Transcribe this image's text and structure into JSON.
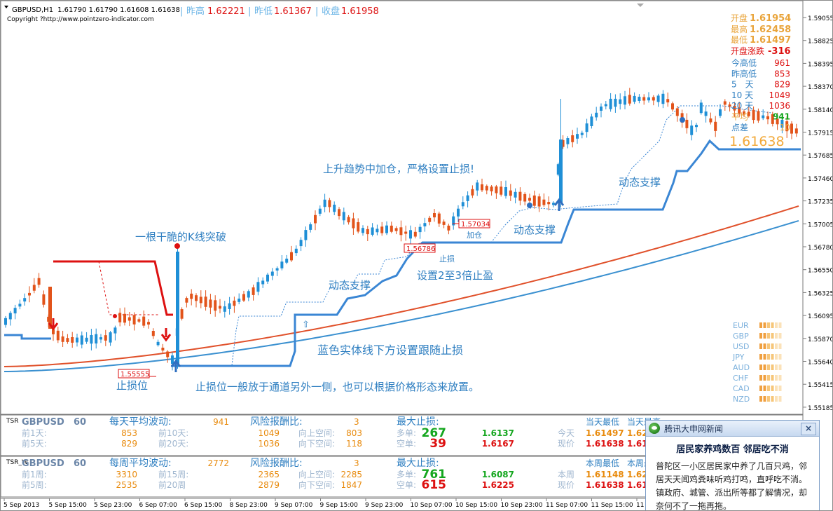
{
  "header": {
    "symbol": "GBPUSD,H1",
    "ohlc": "1.61790 1.61790 1.61608 1.61638",
    "copyright": "Copyright ?http://www.pointzero-indicator.com",
    "stats": [
      {
        "label": "昨高",
        "value": "1.62221"
      },
      {
        "label": "昨低",
        "value": "1.61367"
      },
      {
        "label": "收盘",
        "value": "1.61958"
      }
    ]
  },
  "right_info": {
    "open_label": "开盘",
    "open_value": "1.61954",
    "high_label": "最高",
    "high_value": "1.62458",
    "low_label": "最低",
    "low_value": "1.61497",
    "change_label": "开盘涨跌",
    "change_value": "-316",
    "rows": [
      {
        "label": "今高低",
        "value": "961"
      },
      {
        "label": "昨高低",
        "value": "853"
      },
      {
        "label": "5　天",
        "value": "829"
      },
      {
        "label": "10 天",
        "value": "1049"
      },
      {
        "label": "20 天",
        "value": "1036"
      },
      {
        "label": "平均",
        "value": "941"
      },
      {
        "label": "点差",
        "value": "10"
      }
    ],
    "price": "1.61638"
  },
  "price_axis": [
    "1.59055",
    "1.58825",
    "1.58395",
    "1.58370",
    "1.58140",
    "1.57915",
    "1.57685",
    "1.57460",
    "1.57235",
    "1.57005",
    "1.56780",
    "1.56550",
    "1.56325",
    "1.56095",
    "1.55870",
    "1.55640",
    "1.55415",
    "1.55185"
  ],
  "time_axis": [
    "5 Sep 2013",
    "5 Sep 15:00",
    "5 Sep 23:00",
    "6 Sep 07:00",
    "6 Sep 15:00",
    "8 Sep 23:00",
    "9 Sep 07:00",
    "9 Sep 15:00",
    "9 Sep 23:00",
    "10 Sep 07:00",
    "10 Sep 15:00",
    "10 Sep 23:00",
    "11 Sep 07:00",
    "11 Sep 15:00",
    "11 Sep 23:00"
  ],
  "currencies": [
    "EUR",
    "GBP",
    "USD",
    "JPY",
    "AUD",
    "CHF",
    "CAD",
    "NZD"
  ],
  "annotations": {
    "breakout": "一根干脆的K线突破",
    "uptrend": "上升趋势中加仓，严格设置止损!",
    "dyn_support_1": "动态支撑",
    "dyn_support_2": "动态支撑",
    "dyn_support_3": "动态支撑",
    "take_profit": "设置2至3倍止盈",
    "trailing": "蓝色实体线下方设置跟随止损",
    "stop_note": "止损位一般放于通道另外一侧，也可以根据价格形态来放置。",
    "stop_label": "止损位",
    "stop_small": "止损",
    "add_small": "加仓",
    "box_stop": "1.55555",
    "box_mid": "1.56786",
    "box_add": "1.57034",
    "up_arrow_char": "⇧"
  },
  "panel1": {
    "tag": "TSR",
    "symbol": "GBPUSD",
    "period": "60",
    "avg_label": "每天平均波动:",
    "avg_value": "941",
    "rr_label": "风险报酬比:",
    "rr_value": "3",
    "maxsl_label": "最大止损:",
    "r1": [
      {
        "l": "前1天:",
        "v": "853"
      },
      {
        "l": "前10天:",
        "v": "1049"
      },
      {
        "l": "向上空间:",
        "v": "803"
      }
    ],
    "r2": [
      {
        "l": "前5天:",
        "v": "829"
      },
      {
        "l": "前20天:",
        "v": "1036"
      },
      {
        "l": "向下空间:",
        "v": "118"
      }
    ],
    "long_label": "多单:",
    "long_pts": "267",
    "long_price": "1.6137",
    "short_label": "空单:",
    "short_pts": "39",
    "short_price": "1.6167",
    "right_h1": "当天最低",
    "right_h2": "当天最高",
    "right_r1_label": "今天",
    "right_r1_value": "1.61497",
    "right_r1_value2": "1.62",
    "right_r2_label": "现价",
    "right_r2_value": "1.61638",
    "right_r2_value2": "1.61"
  },
  "panel2": {
    "tag": "TSR_W",
    "symbol": "GBPUSD",
    "period": "60",
    "avg_label": "每周平均波动:",
    "avg_value": "2772",
    "rr_label": "风险报酬比:",
    "rr_value": "3",
    "maxsl_label": "最大止损:",
    "r1": [
      {
        "l": "前1周:",
        "v": "3310"
      },
      {
        "l": "前15周:",
        "v": "2365"
      },
      {
        "l": "向上空间:",
        "v": "2285"
      }
    ],
    "r2": [
      {
        "l": "前5周:",
        "v": "2535"
      },
      {
        "l": "前20周",
        "v": "2879"
      },
      {
        "l": "向下空间:",
        "v": "1847"
      }
    ],
    "long_label": "多单:",
    "long_pts": "761",
    "long_price": "1.6087",
    "short_label": "空单:",
    "short_pts": "615",
    "short_price": "1.6225",
    "right_h1": "本周最低",
    "right_h2": "本周最高",
    "right_r1_label": "本周",
    "right_r1_value": "1.61148",
    "right_r1_value2": "1.62",
    "right_r2_label": "现价",
    "right_r2_value": "1.61638",
    "right_r2_value2": "1.61"
  },
  "popup": {
    "title": "腾讯大申网新闻",
    "close": "×",
    "headline": "居民家养鸡数百 邻居吃不消",
    "lines": [
      "普陀区一小区居民家中养了几百只鸡，邻",
      "居天天闻鸡粪味听鸡打鸣，直呼吃不消。",
      "镇政府、城管、派出所等都了解情况，却",
      "奈何不了一拖再拖。"
    ]
  },
  "colors": {
    "up": "#1f8fd6",
    "down": "#e2531a",
    "trail": "#3a86d4",
    "ema_red": "#e0502a",
    "ema_blue": "#3a90d0",
    "text_blue": "#2f7fc1",
    "red": "#dd1111",
    "green": "#14a61e",
    "orange": "#e88a0c"
  }
}
